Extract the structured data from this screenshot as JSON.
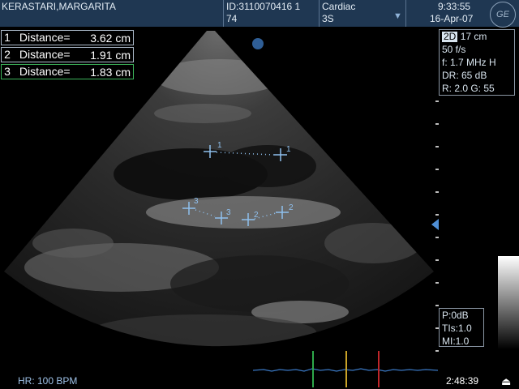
{
  "header": {
    "patient_name": "KERASTARI,MARGARITA",
    "patient_id_line1": "ID:3110070416 1",
    "patient_id_line2": "74",
    "exam_type": "Cardiac",
    "probe": "3S",
    "dropdown_glyph": "▼",
    "time": "9:33:55",
    "date": "16-Apr-07",
    "logo_text": "GE"
  },
  "measurements": [
    {
      "number": "1",
      "label": "Distance=",
      "value": "3.62 cm"
    },
    {
      "number": "2",
      "label": "Distance=",
      "value": "1.91 cm"
    },
    {
      "number": "3",
      "label": "Distance=",
      "value": "1.83 cm"
    }
  ],
  "imaging_params": {
    "mode": "2D",
    "depth": "17 cm",
    "frame_rate": "50 f/s",
    "frequency": "f: 1.7 MHz H",
    "dynamic_range": "DR: 65 dB",
    "reject_gain": "R: 2.0   G: 55"
  },
  "safety": {
    "power": "P:0dB",
    "tis": "TIs:1.0",
    "mi": "MI:1.0"
  },
  "footer": {
    "heart_rate": "HR: 100 BPM",
    "clock": "2:48:39",
    "cine_glyph": "⏏"
  },
  "calipers": {
    "labels": [
      "1",
      "1",
      "2",
      "2",
      "3",
      "3"
    ]
  },
  "colors": {
    "header_bg": "#1f3752",
    "caliper": "#8fc0ee",
    "ecg": "#3a78c4",
    "marker_green": "#2ea84a",
    "marker_yellow": "#c9a227",
    "marker_red": "#c0262a"
  }
}
